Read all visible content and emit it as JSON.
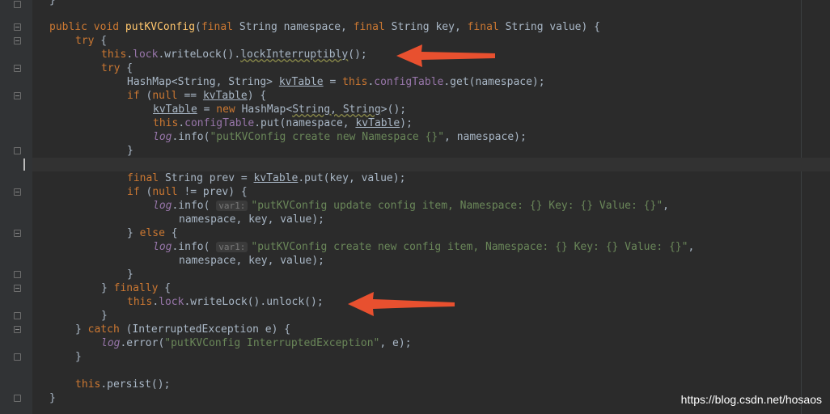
{
  "code": {
    "l0": "}",
    "l1": {
      "kw1": "public void ",
      "name": "putKVConfig",
      "p1": "(",
      "kw2": "final ",
      "t1": "String namespace, ",
      "kw3": "final ",
      "t2": "String key, ",
      "kw4": "final ",
      "t3": "String value) {"
    },
    "l2": {
      "kw": "try",
      "rest": " {"
    },
    "l3": {
      "kw": "this",
      "dot": ".",
      "fld": "lock",
      "rest": ".writeLock().",
      "wavy": "lockInterruptibly",
      "end": "();"
    },
    "l4": {
      "kw": "try",
      "rest": " {"
    },
    "l5": {
      "a": "HashMap<String, String> ",
      "ul": "kvTable",
      "b": " = ",
      "kw": "this",
      "dot": ".",
      "fld": "configTable",
      "c": ".get(namespace);"
    },
    "l6": {
      "kw": "if",
      "a": " (",
      "kw2": "null",
      "b": " == ",
      "ul": "kvTable",
      "c": ") {"
    },
    "l7": {
      "ul": "kvTable",
      "a": " = ",
      "kw": "new",
      "b": " HashMap<",
      "wavy": "String, String",
      "c": ">();"
    },
    "l8": {
      "kw": "this",
      "dot": ".",
      "fld": "configTable",
      "a": ".put(namespace, ",
      "ul": "kvTable",
      "b": ");"
    },
    "l9": {
      "log": "log",
      "a": ".info(",
      "str": "\"putKVConfig create new Namespace {}\"",
      "b": ", namespace);"
    },
    "l10": "}",
    "l12": {
      "kw": "final",
      "a": " String prev = ",
      "ul": "kvTable",
      "b": ".put(key, value);"
    },
    "l13": {
      "kw": "if",
      "a": " (",
      "kw2": "null",
      "b": " != prev) {"
    },
    "l14": {
      "log": "log",
      "a": ".info( ",
      "hint": "var1:",
      "str": "\"putKVConfig update config item, Namespace: {} Key: {} Value: {}\"",
      "b": ","
    },
    "l15": "namespace, key, value);",
    "l16": {
      "a": "} ",
      "kw": "else",
      "b": " {"
    },
    "l17": {
      "log": "log",
      "a": ".info( ",
      "hint": "var1:",
      "str": "\"putKVConfig create new config item, Namespace: {} Key: {} Value: {}\"",
      "b": ","
    },
    "l18": "namespace, key, value);",
    "l19": "}",
    "l20": {
      "a": "} ",
      "kw": "finally",
      "b": " {"
    },
    "l21": {
      "kw": "this",
      "dot": ".",
      "fld": "lock",
      "rest": ".writeLock().unlock();"
    },
    "l22": "}",
    "l23": {
      "a": "} ",
      "kw": "catch",
      "b": " (InterruptedException e) {"
    },
    "l24": {
      "log": "log",
      "a": ".error(",
      "str": "\"putKVConfig InterruptedException\"",
      "b": ", e);"
    },
    "l25": "}",
    "l27": {
      "kw": "this",
      "rest": ".persist();"
    },
    "l28": "}"
  },
  "colors": {
    "background": "#2b2b2b",
    "keyword": "#cc7832",
    "field": "#9876aa",
    "method": "#ffc66d",
    "string": "#6a8759",
    "arrow": "#e8502f"
  },
  "watermark": "https://blog.csdn.net/hosaos"
}
